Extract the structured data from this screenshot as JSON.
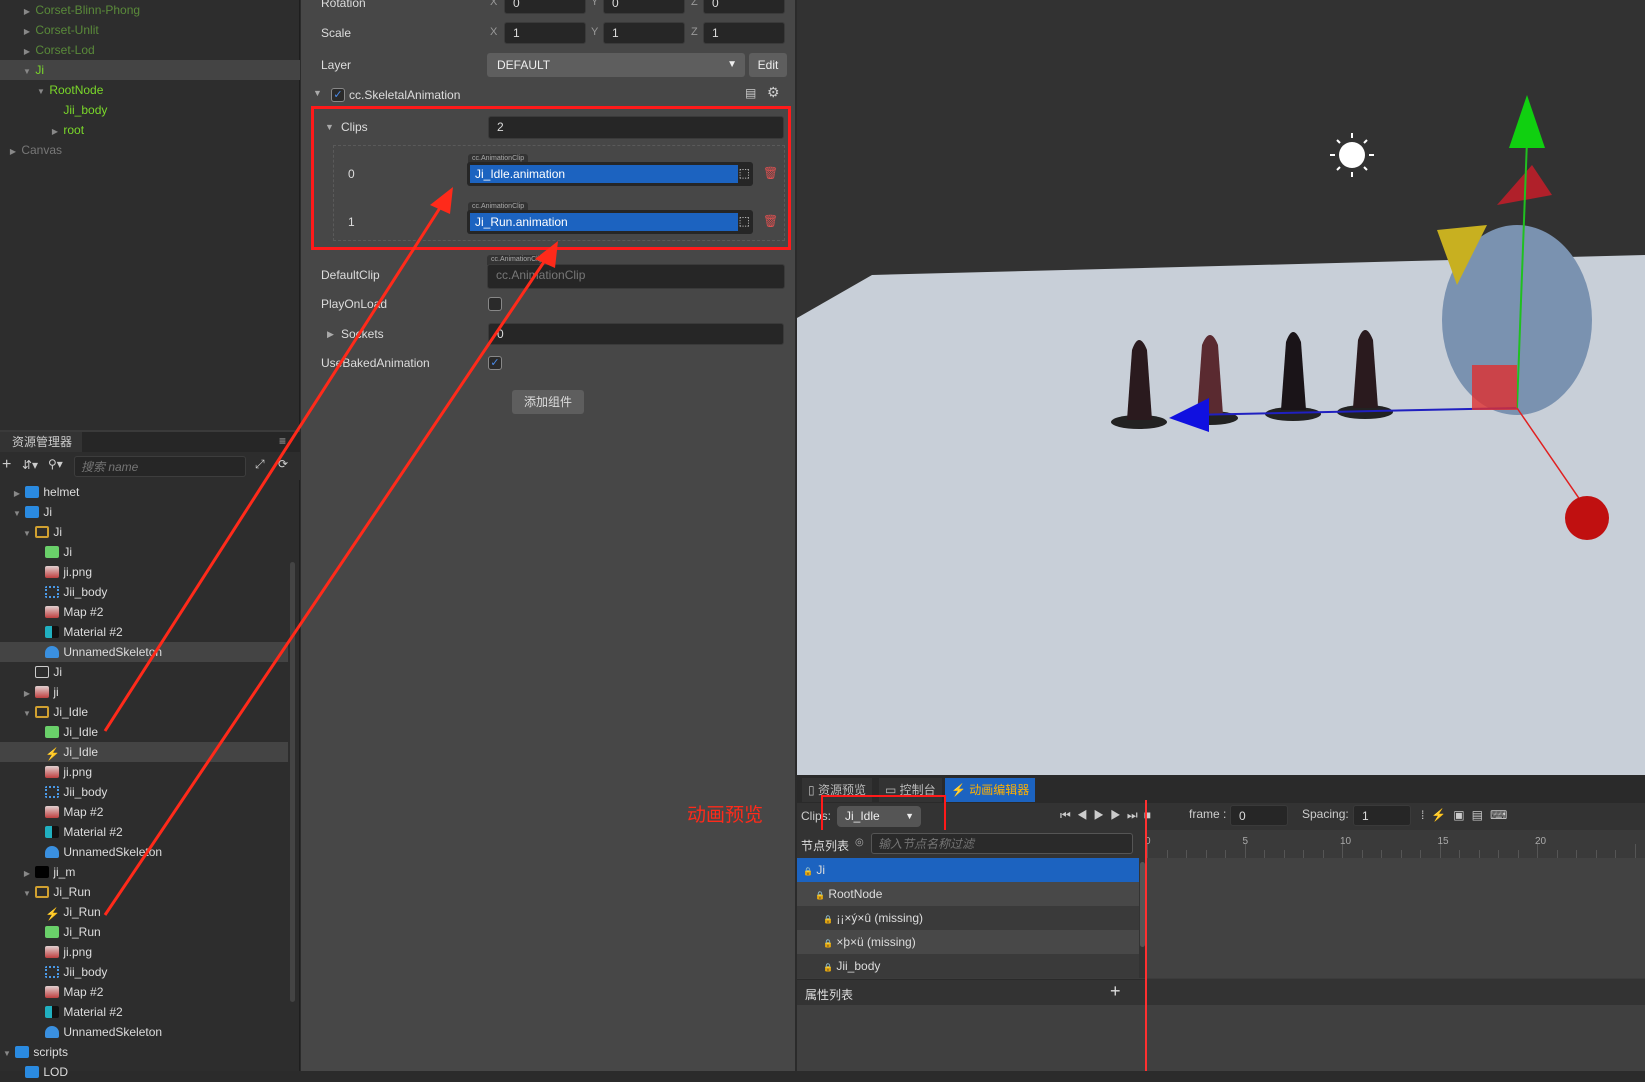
{
  "hierarchy": [
    {
      "label": "Corset-Blinn-Phong",
      "level": 1,
      "arrow": "right",
      "style": ""
    },
    {
      "label": "Corset-Unlit",
      "level": 1,
      "arrow": "right",
      "style": ""
    },
    {
      "label": "Corset-Lod",
      "level": 1,
      "arrow": "right",
      "style": ""
    },
    {
      "label": "Ji",
      "level": 1,
      "arrow": "down",
      "style": "active",
      "selected": true
    },
    {
      "label": "RootNode",
      "level": 2,
      "arrow": "down",
      "style": "active"
    },
    {
      "label": "Jii_body",
      "level": 3,
      "arrow": "",
      "style": "active"
    },
    {
      "label": "root",
      "level": 3,
      "arrow": "right",
      "style": "active"
    },
    {
      "label": "Canvas",
      "level": 0,
      "arrow": "right",
      "style": "dim"
    }
  ],
  "assets": {
    "tab_label": "资源管理器",
    "search_placeholder": "搜索 name",
    "items": [
      {
        "label": "helmet",
        "level": 1,
        "arrow": "right",
        "icon": "folder"
      },
      {
        "label": "Ji",
        "level": 1,
        "arrow": "down",
        "icon": "folder"
      },
      {
        "label": "Ji",
        "level": 2,
        "arrow": "down",
        "icon": "prefab-stack"
      },
      {
        "label": "Ji",
        "level": 3,
        "icon": "mesh-cube"
      },
      {
        "label": "ji.png",
        "level": 3,
        "icon": "texture"
      },
      {
        "label": "Jii_body",
        "level": 3,
        "icon": "mesh-grid"
      },
      {
        "label": "Map #2",
        "level": 3,
        "icon": "texture"
      },
      {
        "label": "Material #2",
        "level": 3,
        "icon": "material"
      },
      {
        "label": "UnnamedSkeleton",
        "level": 3,
        "icon": "skeleton",
        "selected": true
      },
      {
        "label": "Ji",
        "level": 2,
        "icon": "file"
      },
      {
        "label": "ji",
        "level": 2,
        "arrow": "right",
        "icon": "texture"
      },
      {
        "label": "Ji_Idle",
        "level": 2,
        "arrow": "down",
        "icon": "prefab-stack"
      },
      {
        "label": "Ji_Idle",
        "level": 3,
        "icon": "mesh-cube"
      },
      {
        "label": "Ji_Idle",
        "level": 3,
        "icon": "animation",
        "selected": true
      },
      {
        "label": "ji.png",
        "level": 3,
        "icon": "texture"
      },
      {
        "label": "Jii_body",
        "level": 3,
        "icon": "mesh-grid"
      },
      {
        "label": "Map #2",
        "level": 3,
        "icon": "texture"
      },
      {
        "label": "Material #2",
        "level": 3,
        "icon": "material"
      },
      {
        "label": "UnnamedSkeleton",
        "level": 3,
        "icon": "skeleton"
      },
      {
        "label": "ji_m",
        "level": 2,
        "arrow": "right",
        "icon": "black"
      },
      {
        "label": "Ji_Run",
        "level": 2,
        "arrow": "down",
        "icon": "prefab-stack"
      },
      {
        "label": "Ji_Run",
        "level": 3,
        "icon": "animation"
      },
      {
        "label": "Ji_Run",
        "level": 3,
        "icon": "mesh-cube"
      },
      {
        "label": "ji.png",
        "level": 3,
        "icon": "texture"
      },
      {
        "label": "Jii_body",
        "level": 3,
        "icon": "mesh-grid"
      },
      {
        "label": "Map #2",
        "level": 3,
        "icon": "texture"
      },
      {
        "label": "Material #2",
        "level": 3,
        "icon": "material"
      },
      {
        "label": "UnnamedSkeleton",
        "level": 3,
        "icon": "skeleton"
      },
      {
        "label": "scripts",
        "level": 0,
        "arrow": "down",
        "icon": "folder"
      },
      {
        "label": "LOD",
        "level": 1,
        "icon": "folder"
      }
    ]
  },
  "inspector": {
    "rotation": {
      "label": "Rotation",
      "x": "0",
      "y": "0",
      "z": "0"
    },
    "scale": {
      "label": "Scale",
      "x": "1",
      "y": "1",
      "z": "1"
    },
    "axis": {
      "x": "X",
      "y": "Y",
      "z": "Z"
    },
    "layer": {
      "label": "Layer",
      "value": "DEFAULT",
      "edit": "Edit"
    },
    "component": {
      "name": "cc.SkeletalAnimation",
      "enabled": true
    },
    "clips": {
      "label": "Clips",
      "count": "2",
      "type_tag": "cc.AnimationClip",
      "items": [
        {
          "index": "0",
          "value": "Ji_Idle.animation"
        },
        {
          "index": "1",
          "value": "Ji_Run.animation"
        }
      ]
    },
    "default_clip": {
      "label": "DefaultClip",
      "tag": "cc.AnimationClip",
      "placeholder": "cc.AnimationClip"
    },
    "play_on_load": {
      "label": "PlayOnLoad",
      "checked": false
    },
    "sockets": {
      "label": "Sockets",
      "value": "0"
    },
    "use_baked": {
      "label": "UseBakedAnimation",
      "checked": true
    },
    "add_component": "添加组件"
  },
  "annotation": {
    "text": "动画预览",
    "color": "#ff2a1a"
  },
  "anim_editor": {
    "tabs": [
      {
        "label": "资源预览"
      },
      {
        "label": "控制台"
      },
      {
        "label": "动画编辑器",
        "active": true
      }
    ],
    "clips_label": "Clips:",
    "clip_value": "Ji_Idle",
    "frame_label": "frame :",
    "frame_value": "0",
    "spacing_label": "Spacing:",
    "spacing_value": "1",
    "node_list_label": "节点列表",
    "node_filter_placeholder": "输入节点名称过滤",
    "ticks": [
      "0",
      "5",
      "10",
      "15",
      "20"
    ],
    "nodes": [
      {
        "label": "Ji",
        "selected": true
      },
      {
        "label": "RootNode"
      },
      {
        "label": "¡¡×ý×û (missing)"
      },
      {
        "label": "×þ×ü (missing)"
      },
      {
        "label": "Jii_body"
      }
    ],
    "property_list_label": "属性列表"
  },
  "colors": {
    "accent": "#1c63c0",
    "highlight_red": "#ff2a1a",
    "active_node": "#7ad82a",
    "tab_active_text": "#ffb000"
  }
}
